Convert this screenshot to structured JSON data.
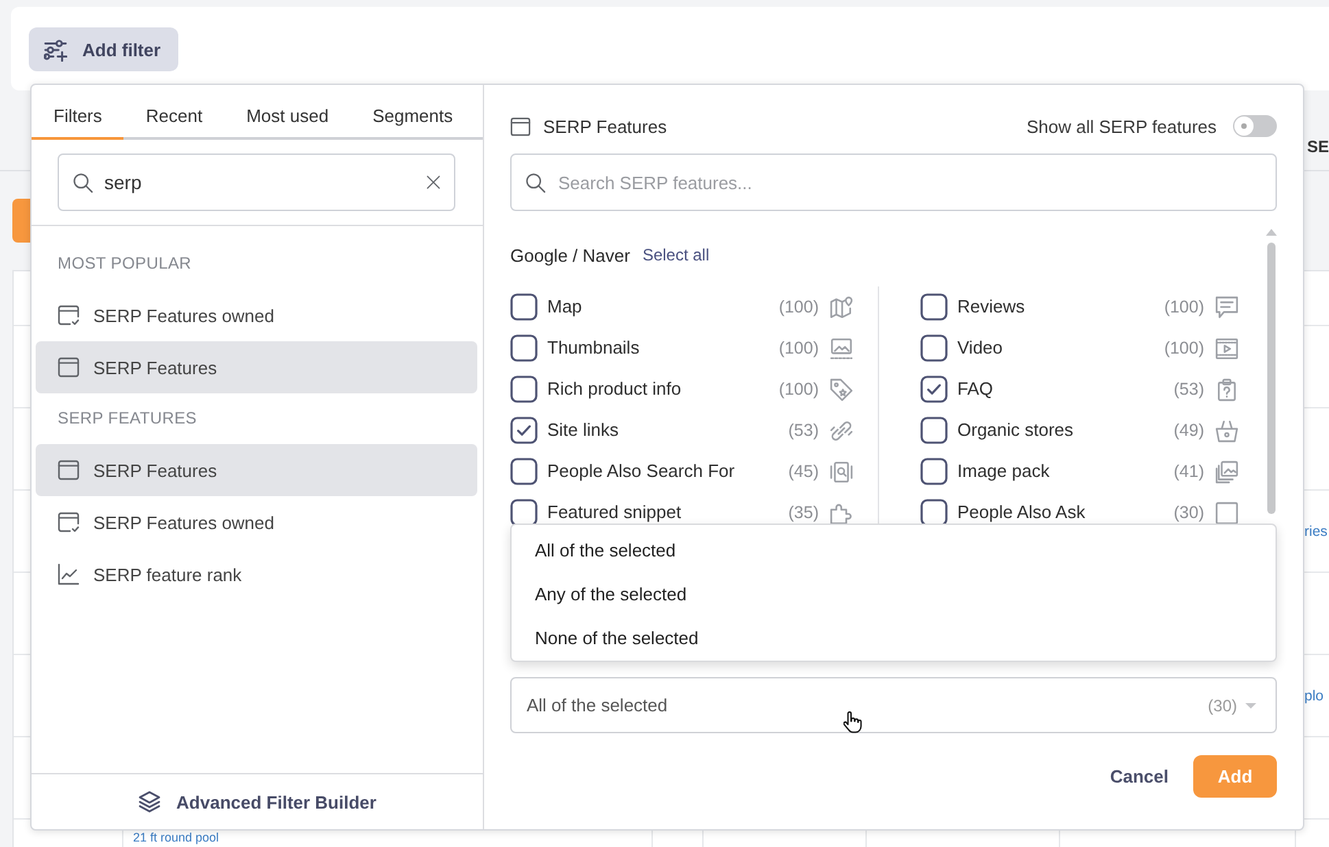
{
  "toolbar": {
    "add_filter": "Add filter"
  },
  "table": {
    "header": "SE",
    "rows": [
      {},
      {},
      {
        "last_cell": "ries"
      },
      {},
      {
        "last_cell": "plo"
      },
      {},
      {
        "name_cell": "21 ft round pool"
      }
    ]
  },
  "filter_panel": {
    "tabs": [
      {
        "label": "Filters",
        "selected": true
      },
      {
        "label": "Recent",
        "selected": false
      },
      {
        "label": "Most used",
        "selected": false
      },
      {
        "label": "Segments",
        "selected": false
      }
    ],
    "search": {
      "value": "serp"
    },
    "sections": [
      {
        "heading": "MOST POPULAR",
        "items": [
          {
            "label": "SERP Features owned",
            "kind": "owned",
            "selected": false
          },
          {
            "label": "SERP Features",
            "kind": "feature",
            "selected": true
          }
        ]
      },
      {
        "heading": "SERP FEATURES",
        "items": [
          {
            "label": "SERP Features",
            "kind": "feature",
            "selected": true
          },
          {
            "label": "SERP Features owned",
            "kind": "owned",
            "selected": false
          },
          {
            "label": "SERP feature rank",
            "kind": "rank",
            "selected": false
          }
        ]
      }
    ],
    "footer_link": "Advanced Filter Builder"
  },
  "feature_panel": {
    "title": "SERP Features",
    "show_all": {
      "label": "Show all SERP features",
      "on": false
    },
    "search": {
      "placeholder": "Search SERP features..."
    },
    "group": {
      "name": "Google / Naver",
      "select_all": "Select all"
    },
    "columns": [
      {
        "items": [
          {
            "label": "Map",
            "count": "(100)",
            "kind": "map",
            "checked": false
          },
          {
            "label": "Thumbnails",
            "count": "(100)",
            "kind": "thumbnails",
            "checked": false
          },
          {
            "label": "Rich product info",
            "count": "(100)",
            "kind": "product",
            "checked": false
          },
          {
            "label": "Site links",
            "count": "(53)",
            "kind": "sitelinks",
            "checked": true
          },
          {
            "label": "People Also Search For",
            "count": "(45)",
            "kind": "pasf",
            "checked": false
          },
          {
            "label": "Featured snippet",
            "count": "(35)",
            "kind": "snippet",
            "checked": false
          }
        ]
      },
      {
        "items": [
          {
            "label": "Reviews",
            "count": "(100)",
            "kind": "reviews",
            "checked": false
          },
          {
            "label": "Video",
            "count": "(100)",
            "kind": "video",
            "checked": false
          },
          {
            "label": "FAQ",
            "count": "(53)",
            "kind": "faq",
            "checked": true
          },
          {
            "label": "Organic stores",
            "count": "(49)",
            "kind": "stores",
            "checked": false
          },
          {
            "label": "Image pack",
            "count": "(41)",
            "kind": "images",
            "checked": false
          },
          {
            "label": "People Also Ask",
            "count": "(30)",
            "kind": "paa",
            "checked": false
          }
        ]
      }
    ],
    "match_menu": {
      "options": [
        "All of the selected",
        "Any of the selected",
        "None of the selected"
      ]
    },
    "match_select": {
      "value": "All of the selected",
      "count": "(30)"
    },
    "buttons": {
      "cancel": "Cancel",
      "add": "Add"
    }
  }
}
